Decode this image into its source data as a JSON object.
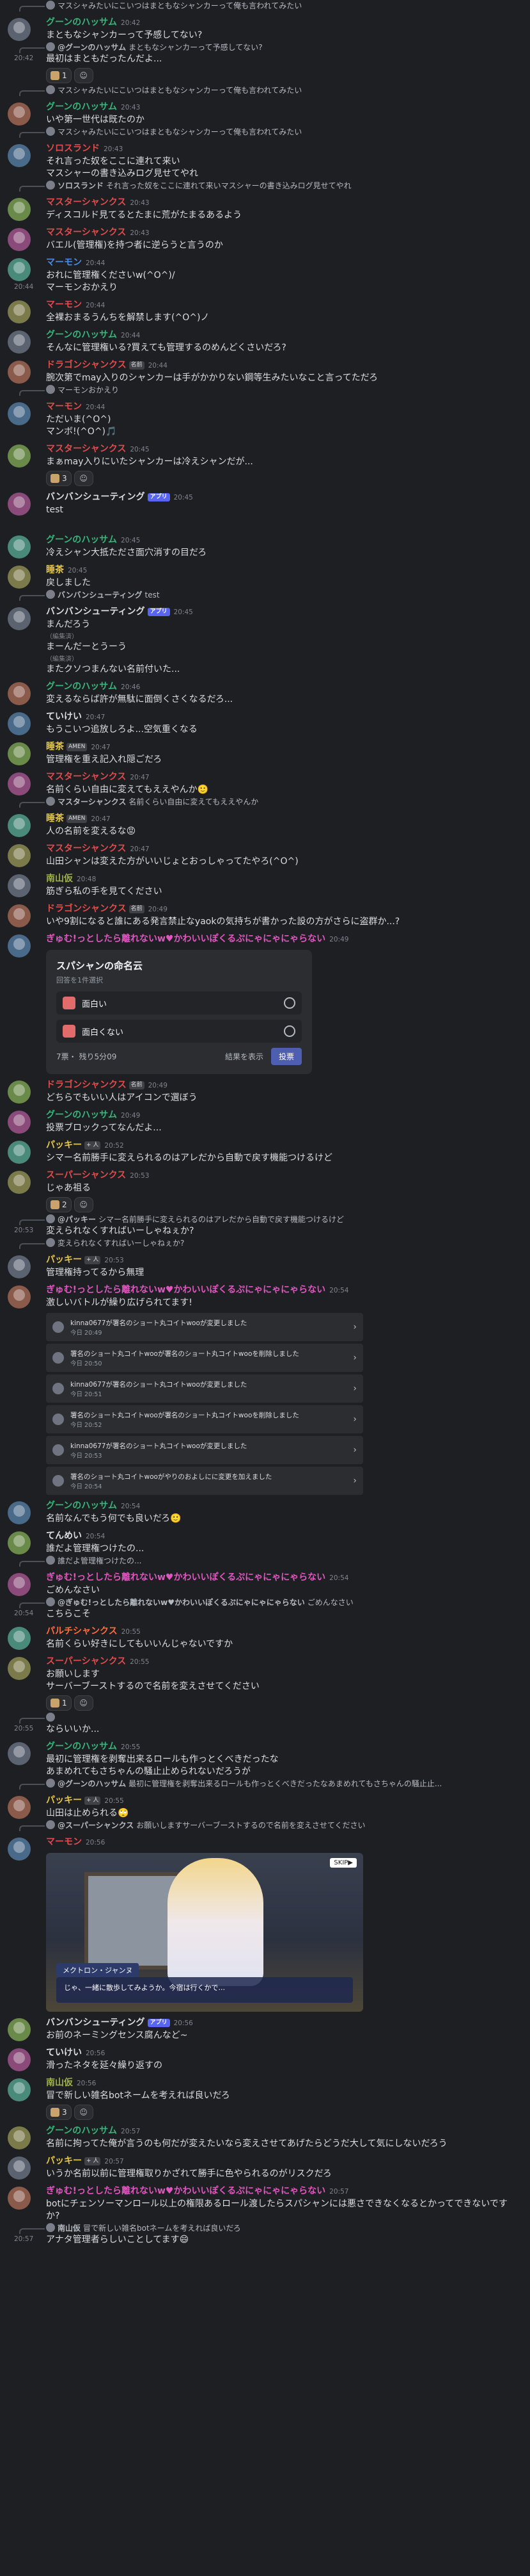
{
  "colors": {
    "background": "#1e1f23",
    "name_green": "#38b57a",
    "name_red": "#e04c4c",
    "name_blue": "#4c8ce0",
    "name_pink": "#e056c0",
    "name_yellow": "#e3c54a",
    "name_white": "#dbdee1",
    "name_olive": "#9cb04b",
    "name_teal": "#2fb0a6",
    "name_lightblue": "#7aa6f0",
    "name_orange": "#ff6b3d",
    "mention": "#c9cdfb"
  },
  "badges": {
    "app": "アプリ",
    "namae": "名前",
    "amen": "AMEN",
    "plus": "+ 人"
  },
  "messages": [
    {
      "type": "reply",
      "name": "",
      "text": "マスシャみたいにこいつはまともなシャンカーって俺も言われてみたい"
    },
    {
      "type": "msg",
      "name": "グーンのハッサム",
      "color": "#38b57a",
      "time": "20:42",
      "lines": [
        "まともなシャンカーって予感してない?"
      ]
    },
    {
      "type": "reply",
      "name": "@グーンのハッサム",
      "text": "まともなシャンカーって予感してない?"
    },
    {
      "type": "cont",
      "time": "20:42",
      "lines": [
        "最初はまともだったんだよ..."
      ],
      "reactions": [
        {
          "count": "1"
        }
      ]
    },
    {
      "type": "reply",
      "name": "",
      "text": "マスシャみたいにこいつはまともなシャンカーって俺も言われてみたい"
    },
    {
      "type": "msg",
      "name": "グーンのハッサム",
      "color": "#38b57a",
      "time": "20:43",
      "lines": [
        "いや第一世代は既たのか"
      ]
    },
    {
      "type": "reply",
      "name": "",
      "text": "マスシャみたいにこいつはまともなシャンカーって俺も言われてみたい"
    },
    {
      "type": "msg",
      "name": "ソロスランド",
      "color": "#e04c4c",
      "time": "20:43",
      "lines": [
        "それ言った奴をここに連れて来い",
        "マスシャーの書き込みログ見せてやれ"
      ]
    },
    {
      "type": "reply",
      "name": "ソロスランド",
      "text": "それ言った奴をここに連れて来いマスシャーの書き込みログ見せてやれ"
    },
    {
      "type": "msg",
      "name": "マスターシャンクス",
      "color": "#e04c4c",
      "time": "20:43",
      "lines": [
        "ディスコルド見てるとたまに荒がたまるあるよう"
      ]
    },
    {
      "type": "msg",
      "name": "マスターシャンクス",
      "color": "#e04c4c",
      "time": "20:43",
      "lines": [
        "バエル(管理権)を持つ者に逆らうと言うのか"
      ]
    },
    {
      "type": "msg",
      "name": "マーモン",
      "color": "#4c8ce0",
      "time": "20:44",
      "lines": [
        "おれに管理権くださいw(^O^)/"
      ]
    },
    {
      "type": "cont",
      "time": "20:44",
      "lines": [
        "マーモンおかえり"
      ]
    },
    {
      "type": "msg",
      "name": "マーモン",
      "color": "#e04c4c",
      "time": "20:44",
      "lines": [
        "全裸おまるうんちを解禁します(^O^)ノ"
      ]
    },
    {
      "type": "msg",
      "name": "グーンのハッサム",
      "color": "#38b57a",
      "time": "20:44",
      "lines": [
        "そんなに管理権いる?買えても管理するのめんどくさいだろ?"
      ]
    },
    {
      "type": "msg",
      "name": "ドラゴンシャンクス",
      "color": "#e04c4c",
      "badge": "名前",
      "time": "20:44",
      "lines": [
        "腕次第でmay入りのシャンカーは手がかかりない鋼等生みたいなこと言ってただろ"
      ]
    },
    {
      "type": "reply",
      "name": "",
      "text": "マーモンおかえり"
    },
    {
      "type": "msg",
      "name": "マーモン",
      "color": "#e04c4c",
      "time": "20:44",
      "lines": [
        "ただいま(^O^)",
        "マンボ!(^O^)🎵"
      ]
    },
    {
      "type": "msg",
      "name": "マスターシャンクス",
      "color": "#e04c4c",
      "time": "20:45",
      "lines": [
        "まぁmay入りにいたシャンカーは冷えシャンだが..."
      ],
      "reactions": [
        {
          "count": "3"
        }
      ]
    },
    {
      "type": "msg",
      "name": "バンバンシューティング",
      "color": "#dbdee1",
      "badge": "アプリ",
      "time": "20:45",
      "lines": [
        "test"
      ]
    },
    {
      "type": "divider"
    },
    {
      "type": "msg",
      "name": "グーンのハッサム",
      "color": "#38b57a",
      "time": "20:45",
      "lines": [
        "冷えシャン大抵たださ面穴消すの目だろ"
      ]
    },
    {
      "type": "msg",
      "name": "睡茶",
      "color": "#e3c54a",
      "time": "20:45",
      "lines": [
        "戻しました"
      ]
    },
    {
      "type": "reply",
      "name": "バンバンシューティング",
      "text": "test"
    },
    {
      "type": "msg",
      "name": "バンバンシューティング",
      "color": "#dbdee1",
      "badge": "アプリ",
      "time": "20:45",
      "lines": [
        "まんだろう"
      ]
    },
    {
      "type": "edited",
      "text": "（編集済）"
    },
    {
      "type": "cont",
      "time": "",
      "lines": [
        "まーんだーとうーう"
      ]
    },
    {
      "type": "edited",
      "text": "（編集済）"
    },
    {
      "type": "cont",
      "time": "",
      "lines": [
        "またクソつまんない名前付いた..."
      ]
    },
    {
      "type": "msg",
      "name": "グーンのハッサム",
      "color": "#38b57a",
      "time": "20:46",
      "lines": [
        "変えるならば許が無駄に面倒くさくなるだろ..."
      ]
    },
    {
      "type": "msg",
      "name": "ていけい",
      "color": "#dbdee1",
      "time": "20:47",
      "lines": [
        "もうこいつ追放しろよ...空気重くなる"
      ]
    },
    {
      "type": "msg",
      "name": "睡茶",
      "color": "#e3c54a",
      "badge": "AMEN",
      "time": "20:47",
      "lines": [
        "管理権を重え記入れ隠ごだろ"
      ]
    },
    {
      "type": "msg",
      "name": "マスターシャンクス",
      "color": "#e04c4c",
      "time": "20:47",
      "lines": [
        "名前くらい自由に変えてもええやんか🙂"
      ]
    },
    {
      "type": "reply",
      "name": "マスターシャンクス",
      "text": "名前くらい自由に変えてもええやんか"
    },
    {
      "type": "msg",
      "name": "睡茶",
      "color": "#e3c54a",
      "badge": "AMEN",
      "time": "20:47",
      "lines": [
        "人の名前を変えるな😡"
      ]
    },
    {
      "type": "msg",
      "name": "マスターシャンクス",
      "color": "#e04c4c",
      "time": "20:47",
      "lines": [
        "山田シャンは変えた方がいいじょとおっしゃってたやろ(^O^)"
      ]
    },
    {
      "type": "msg",
      "name": "南山仮",
      "color": "#9cb04b",
      "time": "20:48",
      "lines": [
        "筋ぎら私の手を見てください"
      ]
    },
    {
      "type": "msg",
      "name": "ドラゴンシャンクス",
      "color": "#e04c4c",
      "badge": "名前",
      "time": "20:49",
      "lines": [
        "いや9割になると誰にある発言禁止なyaokの気持ちが書かった設の方がさらに盗群か...?"
      ]
    },
    {
      "type": "msg",
      "name": "ぎゅむ!っとしたら離れないw♥かわいいぽくるぷにゃにゃにゃらない",
      "color": "#e056c0",
      "time": "20:49",
      "lines": []
    },
    {
      "type": "poll",
      "question": "スパシャンの命名云",
      "sub": "回答を1件選択",
      "options": [
        "面白い",
        "面白くない"
      ],
      "votes": "7票",
      "left": "残り5分09",
      "results": "結果を表示",
      "vote": "投票"
    },
    {
      "type": "msg",
      "name": "ドラゴンシャンクス",
      "color": "#e04c4c",
      "badge": "名前",
      "time": "20:49",
      "lines": [
        "どちらでもいい人はアイコンで選ぼう"
      ]
    },
    {
      "type": "msg",
      "name": "グーンのハッサム",
      "color": "#38b57a",
      "time": "20:49",
      "lines": [
        "投票ブロックってなんだよ..."
      ]
    },
    {
      "type": "msg",
      "name": "パッキー",
      "color": "#e3c54a",
      "badge": "+ 人",
      "time": "20:52",
      "lines": [
        "シマー名前勝手に変えられるのはアレだから自動で戻す機能つけるけど"
      ]
    },
    {
      "type": "msg",
      "name": "スーパーシャンクス",
      "color": "#e04c4c",
      "time": "20:53",
      "lines": [
        "じゃあ祖る"
      ],
      "reactions": [
        {
          "count": "2"
        }
      ]
    },
    {
      "type": "reply",
      "name": "@パッキー",
      "text": "シマー名前勝手に変えられるのはアレだから自動で戻す機能つけるけど"
    },
    {
      "type": "cont",
      "time": "20:53",
      "lines": [
        "変えられなくすればいーしゃねぇか?"
      ]
    },
    {
      "type": "reply",
      "name": "",
      "text": "変えられなくすればいーしゃねぇか?"
    },
    {
      "type": "msg",
      "name": "パッキー",
      "color": "#e3c54a",
      "badge": "+ 人",
      "time": "20:53",
      "lines": [
        "管理権持ってるから無理"
      ]
    },
    {
      "type": "msg",
      "name": "ぎゅむ!っとしたら離れないw♥かわいいぽくるぷにゃにゃにゃらない",
      "color": "#e056c0",
      "time": "20:54",
      "lines": [
        "激しいバトルが繰り広げられてます!"
      ]
    },
    {
      "type": "embeds",
      "rows": [
        {
          "t": "kinna0677が署名のショート丸コイトwooが変更しました",
          "s": "今日 20:49"
        },
        {
          "t": "署名のショート丸コイトwooが署名のショート丸コイトwooを削除しました",
          "s": "今日 20:50"
        },
        {
          "t": "kinna0677が署名のショート丸コイトwooが変更しました",
          "s": "今日 20:51"
        },
        {
          "t": "署名のショート丸コイトwooが署名のショート丸コイトwooを削除しました",
          "s": "今日 20:52"
        },
        {
          "t": "kinna0677が署名のショート丸コイトwooが変更しました",
          "s": "今日 20:53"
        },
        {
          "t": "署名のショート丸コイトwooがやりのおよしにに変更を加えました",
          "s": "今日 20:54"
        }
      ]
    },
    {
      "type": "msg",
      "name": "グーンのハッサム",
      "color": "#38b57a",
      "time": "20:54",
      "lines": [
        "名前なんでもう何でも良いだろ🙂"
      ]
    },
    {
      "type": "msg",
      "name": "てんめい",
      "color": "#dbdee1",
      "time": "20:54",
      "lines": [
        "誰だよ管理権つけたの..."
      ]
    },
    {
      "type": "reply",
      "name": "",
      "text": "誰だよ管理権つけたの..."
    },
    {
      "type": "msg",
      "name": "ぎゅむ!っとしたら離れないw♥かわいいぽくるぷにゃにゃにゃらない",
      "color": "#e056c0",
      "time": "20:54",
      "lines": [
        "ごめんなさい"
      ]
    },
    {
      "type": "reply",
      "name": "@ぎゅむ!っとしたら離れないw♥かわいいぽくるぷにゃにゃにゃらない",
      "text": "ごめんなさい"
    },
    {
      "type": "cont",
      "time": "20:54",
      "lines": [
        "こちらこそ"
      ]
    },
    {
      "type": "msg",
      "name": "パルチシャンクス",
      "color": "#ff6b3d",
      "time": "20:55",
      "lines": [
        "名前くらい好きにしてもいいんじゃないですか"
      ]
    },
    {
      "type": "msg",
      "name": "スーパーシャンクス",
      "color": "#e04c4c",
      "time": "20:55",
      "lines": [
        "お願いします",
        "サーバーブーストするので名前を変えさせてください"
      ],
      "reactions": [
        {
          "count": "1"
        }
      ]
    },
    {
      "type": "reply",
      "name": "",
      "text": ""
    },
    {
      "type": "cont",
      "time": "20:55",
      "lines": [
        "ならいいか..."
      ]
    },
    {
      "type": "msg",
      "name": "グーンのハッサム",
      "color": "#38b57a",
      "time": "20:55",
      "lines": [
        "最初に管理権を剥奪出来るロールも作っとくべきだったな",
        "あまめれてもさちゃんの騒止止められないだろうが"
      ]
    },
    {
      "type": "reply",
      "name": "@グーンのハッサム",
      "text": "最初に管理権を剥奪出来るロールも作っとくべきだったなあまめれてもさちゃんの騒止止..."
    },
    {
      "type": "msg",
      "name": "パッキー",
      "color": "#e3c54a",
      "badge": "+ 人",
      "time": "20:55",
      "lines": [
        "山田は止められる🙄"
      ]
    },
    {
      "type": "reply",
      "name": "@スーパーシャンクス",
      "text": "お願いしますサーバーブーストするので名前を変えさせてください"
    },
    {
      "type": "msg",
      "name": "マーモン",
      "color": "#e04c4c",
      "time": "20:56",
      "lines": []
    },
    {
      "type": "game",
      "skip": "SKIP▶",
      "speaker": "メクトロン・ジャンヌ",
      "dialogue": "じゃ、一緒に散歩してみようか。今宿は行くかで..."
    },
    {
      "type": "msg",
      "name": "バンバンシューティング",
      "color": "#dbdee1",
      "badge": "アプリ",
      "time": "20:56",
      "lines": [
        "お前のネーミングセンス腐んなど~"
      ]
    },
    {
      "type": "msg",
      "name": "ていけい",
      "color": "#dbdee1",
      "time": "20:56",
      "lines": [
        "滑ったネタを延々繰り返すの"
      ]
    },
    {
      "type": "msg",
      "name": "南山仮",
      "color": "#9cb04b",
      "time": "20:56",
      "lines": [
        "冒で新しい雑名botネームを考えれば良いだろ"
      ],
      "reactions": [
        {
          "count": "3"
        }
      ]
    },
    {
      "type": "msg",
      "name": "グーンのハッサム",
      "color": "#38b57a",
      "time": "20:57",
      "lines": [
        "名前に拘ってた俺が言うのも何だが変えたいなら変えさせてあげたらどうだ大して気にしないだろう"
      ]
    },
    {
      "type": "msg",
      "name": "パッキー",
      "color": "#e3c54a",
      "badge": "+ 人",
      "time": "20:57",
      "lines": [
        "いうか名前以前に管理権取りかざれて勝手に色やられるのがリスクだろ"
      ]
    },
    {
      "type": "msg",
      "name": "ぎゅむ!っとしたら離れないw♥かわいいぽくるぷにゃにゃにゃらない",
      "color": "#e056c0",
      "time": "20:57",
      "lines": [
        "botにチェンソーマンロール以上の権限あるロール渡したらスパシャンには悪さできなくなるとかってできないですか?"
      ]
    },
    {
      "type": "reply",
      "name": "南山仮",
      "text": "冒で新しい雑名botネームを考えれば良いだろ"
    },
    {
      "type": "cont",
      "time": "20:57",
      "lines": [
        "アナタ管理者らしいことしてます😄"
      ]
    }
  ]
}
